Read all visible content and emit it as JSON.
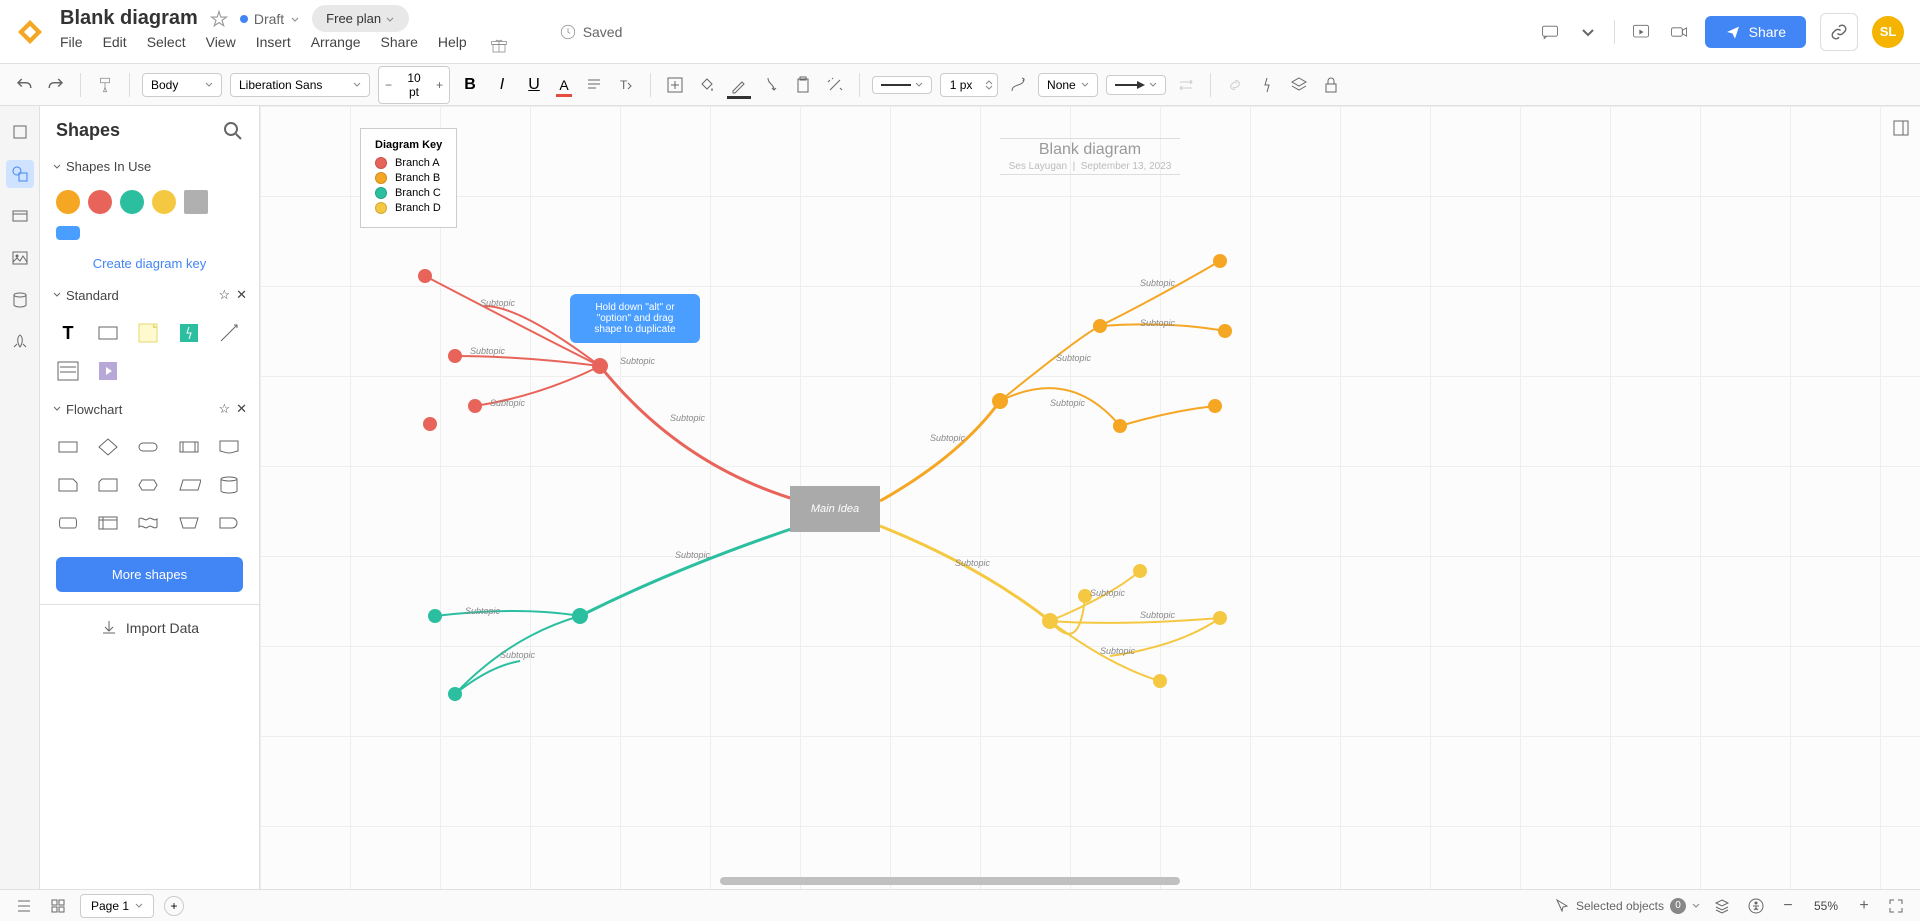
{
  "header": {
    "title": "Blank diagram",
    "status": "Draft",
    "plan": "Free plan",
    "saved": "Saved",
    "share": "Share",
    "avatar": "SL",
    "menu": [
      "File",
      "Edit",
      "Select",
      "View",
      "Insert",
      "Arrange",
      "Share",
      "Help"
    ]
  },
  "toolbar": {
    "shape_style": "Body",
    "font": "Liberation Sans",
    "font_size": "10 pt",
    "line_width": "1 px",
    "line_end": "None"
  },
  "panel": {
    "title": "Shapes",
    "sections": {
      "in_use": "Shapes In Use",
      "standard": "Standard",
      "flowchart": "Flowchart"
    },
    "create_key": "Create diagram key",
    "more_shapes": "More shapes",
    "import_data": "Import Data",
    "colors": [
      "#f5a623",
      "#e8645a",
      "#2bbfa0",
      "#f5a623",
      "#b0b0b0"
    ]
  },
  "canvas": {
    "title": "Blank diagram",
    "subtitle_left": "Ses Layugan",
    "subtitle_right": "September 13, 2023",
    "main_idea": "Main Idea",
    "tooltip": "Hold down \"alt\" or \"option\" and drag shape to duplicate",
    "diagram_key": {
      "title": "Diagram Key",
      "items": [
        {
          "label": "Branch A",
          "color": "#e8645a"
        },
        {
          "label": "Branch B",
          "color": "#f5a623"
        },
        {
          "label": "Branch C",
          "color": "#2bbfa0"
        },
        {
          "label": "Branch D",
          "color": "#f5c842"
        }
      ]
    },
    "subtopic_label": "Subtopic"
  },
  "footer": {
    "page": "Page 1",
    "selected_label": "Selected objects",
    "selected_count": "0",
    "zoom": "55%"
  }
}
